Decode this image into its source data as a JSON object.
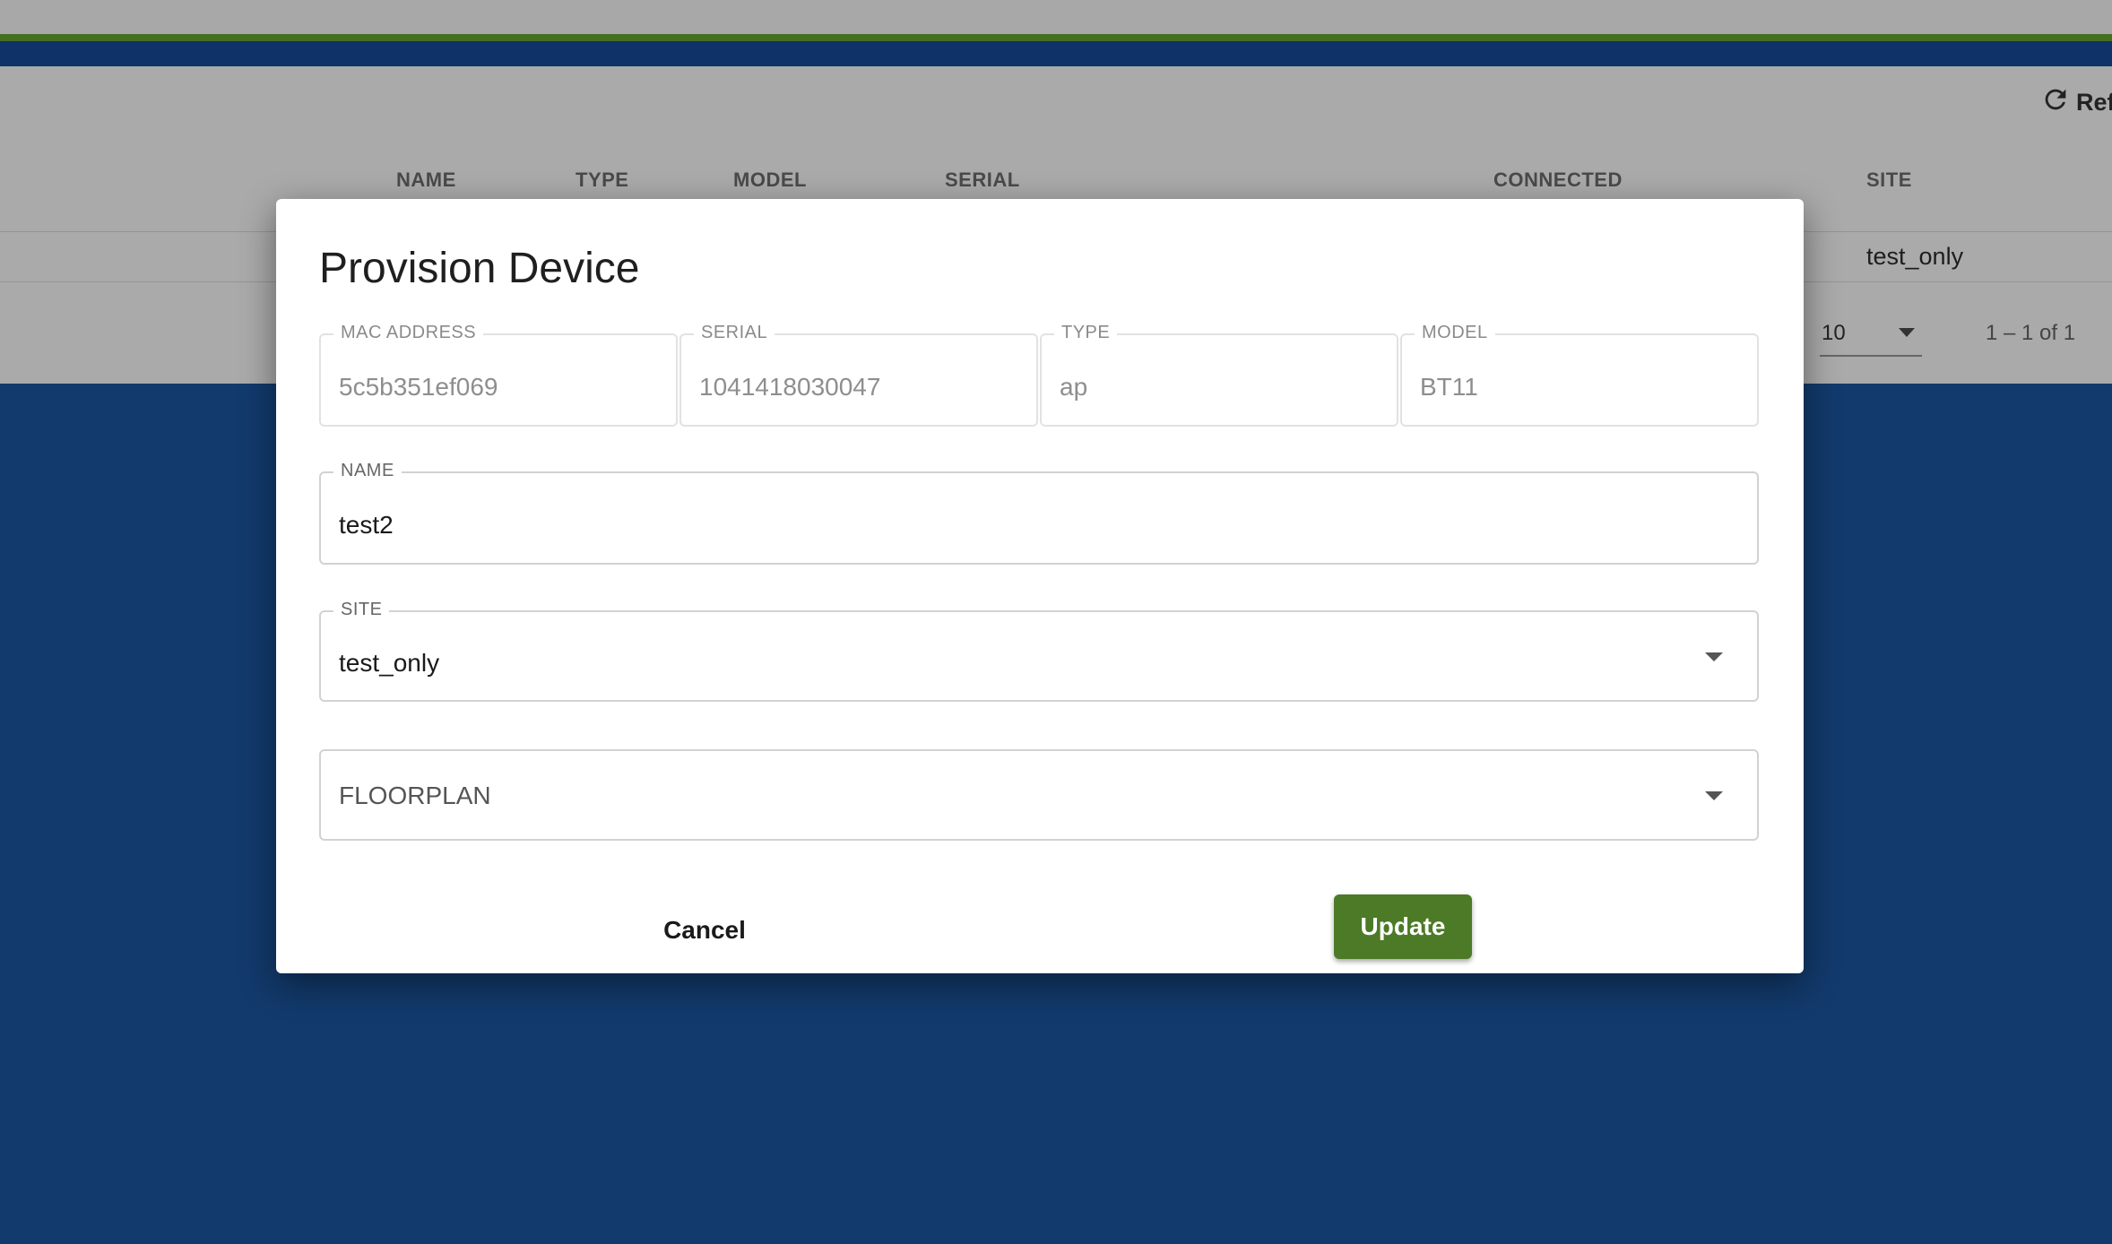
{
  "background": {
    "toolbar": {
      "refresh_label": "Ref"
    },
    "table": {
      "columns": [
        "NAME",
        "TYPE",
        "MODEL",
        "SERIAL",
        "CONNECTED",
        "SITE"
      ],
      "row": {
        "site": "test_only"
      }
    },
    "pagination": {
      "rows_per_page_suffix": ":",
      "rows_per_page": "10",
      "range": "1 – 1 of 1"
    }
  },
  "dialog": {
    "title": "Provision Device",
    "readonly_fields": [
      {
        "label": "MAC ADDRESS",
        "value": "5c5b351ef069"
      },
      {
        "label": "SERIAL",
        "value": "1041418030047"
      },
      {
        "label": "TYPE",
        "value": "ap"
      },
      {
        "label": "MODEL",
        "value": "BT11"
      }
    ],
    "name_field": {
      "label": "NAME",
      "value": "test2"
    },
    "site_field": {
      "label": "SITE",
      "value": "test_only"
    },
    "floorplan_field": {
      "placeholder": "FLOORPLAN"
    },
    "cancel_label": "Cancel",
    "update_label": "Update"
  },
  "colors": {
    "accent_green": "#4c7a26",
    "nav_blue": "#0f3268",
    "page_blue": "#123a6c"
  },
  "icons": {
    "refresh": "refresh-icon",
    "dropdown": "chevron-down-icon"
  }
}
